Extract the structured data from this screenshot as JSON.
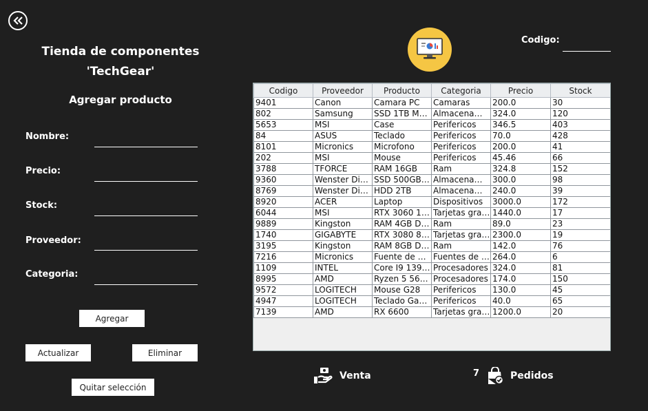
{
  "header": {
    "title_line1": "Tienda de componentes",
    "title_line2": "'TechGear'",
    "subtitle": "Agregar producto"
  },
  "form": {
    "nombre_label": "Nombre:",
    "precio_label": "Precio:",
    "stock_label": "Stock:",
    "proveedor_label": "Proveedor:",
    "categoria_label": "Categoria:",
    "nombre_value": "",
    "precio_value": "",
    "stock_value": "",
    "proveedor_value": "",
    "categoria_value": ""
  },
  "buttons": {
    "agregar": "Agregar",
    "actualizar": "Actualizar",
    "eliminar": "Eliminar",
    "quitar": "Quitar selección"
  },
  "codigo": {
    "label": "Codigo:",
    "value": ""
  },
  "table": {
    "columns": [
      "Codigo",
      "Proveedor",
      "Producto",
      "Categoria",
      "Precio",
      "Stock"
    ],
    "rows": [
      [
        "9401",
        "Canon",
        "Camara PC",
        "Camaras",
        "200.0",
        "30"
      ],
      [
        "802",
        "Samsung",
        "SSD 1TB MV...",
        "Almacenami...",
        "324.0",
        "120"
      ],
      [
        "5653",
        "MSI",
        "Case",
        "Perifericos",
        "346.5",
        "403"
      ],
      [
        "84",
        "ASUS",
        "Teclado",
        "Perifericos",
        "70.0",
        "428"
      ],
      [
        "8101",
        "Micronics",
        "Microfono",
        "Perifericos",
        "200.0",
        "41"
      ],
      [
        "202",
        "MSI",
        "Mouse",
        "Perifericos",
        "45.46",
        "66"
      ],
      [
        "3788",
        "TFORCE",
        "RAM 16GB",
        "Ram",
        "324.8",
        "152"
      ],
      [
        "9360",
        "Wenster Digit...",
        "SSD 500GB ...",
        "Almacenami...",
        "300.0",
        "98"
      ],
      [
        "8769",
        "Wenster Digit...",
        "HDD 2TB",
        "Almacenami...",
        "240.0",
        "39"
      ],
      [
        "8920",
        "ACER",
        "Laptop",
        "Dispositivos",
        "3000.0",
        "172"
      ],
      [
        "6044",
        "MSI",
        "RTX 3060 12...",
        "Tarjetas grafi...",
        "1440.0",
        "17"
      ],
      [
        "9889",
        "Kingston",
        "RAM 4GB DD...",
        "Ram",
        "89.0",
        "23"
      ],
      [
        "1740",
        "GIGABYTE",
        "RTX 3080 8GB",
        "Tarjetas grafi...",
        "2300.0",
        "19"
      ],
      [
        "3195",
        "Kingston",
        "RAM 8GB DD...",
        "Ram",
        "142.0",
        "76"
      ],
      [
        "7216",
        "Micronics",
        "Fuente de 10...",
        "Fuentes de p...",
        "264.0",
        "6"
      ],
      [
        "1109",
        "INTEL",
        "Core I9 1390...",
        "Procesadores",
        "324.0",
        "81"
      ],
      [
        "8995",
        "AMD",
        "Ryzen 5 5600G",
        "Procesadores",
        "174.0",
        "150"
      ],
      [
        "9572",
        "LOGITECH",
        "Mouse G28",
        "Perifericos",
        "130.0",
        "45"
      ],
      [
        "4947",
        "LOGITECH",
        "Teclado Gam...",
        "Perifericos",
        "40.0",
        "65"
      ],
      [
        "7139",
        "AMD",
        "RX 6600",
        "Tarjetas grafi...",
        "1200.0",
        "20"
      ]
    ]
  },
  "footer": {
    "venta_label": "Venta",
    "pedidos_label": "Pedidos",
    "pedidos_count": "7"
  },
  "colors": {
    "background": "#1f1f1f",
    "logo_circle": "#f5c644"
  },
  "icons": [
    "back-arrow-icon",
    "monitor-chart-icon",
    "hand-money-icon",
    "shopping-bag-check-icon"
  ]
}
